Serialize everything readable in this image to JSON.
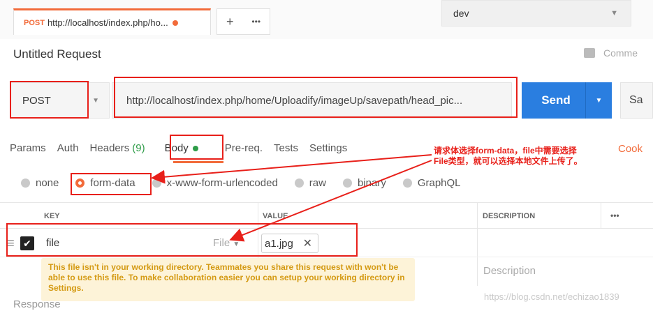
{
  "tabbar": {
    "tab": {
      "method": "POST",
      "url": "http://localhost/index.php/ho..."
    },
    "new_tab": "+",
    "more": "•••",
    "environment": "dev"
  },
  "request": {
    "title": "Untitled Request",
    "comments": "Comme",
    "method": "POST",
    "url": "http://localhost/index.php/home/Uploadify/imageUp/savepath/head_pic...",
    "send": "Send",
    "save": "Sa"
  },
  "req_tabs": {
    "params": "Params",
    "auth": "Auth",
    "headers": "Headers",
    "headers_count": "(9)",
    "body": "Body",
    "prereq": "Pre-req.",
    "tests": "Tests",
    "settings": "Settings",
    "cookies": "Cook"
  },
  "body_types": [
    "none",
    "form-data",
    "x-www-form-urlencoded",
    "raw",
    "binary",
    "GraphQL"
  ],
  "body_type_selected": "form-data",
  "table": {
    "headers": {
      "key": "KEY",
      "value": "VALUE",
      "description": "DESCRIPTION",
      "more": "•••"
    },
    "rows": [
      {
        "key": "file",
        "type": "File",
        "value": "a1.jpg"
      }
    ],
    "description_placeholder": "Description"
  },
  "warning": "This file isn't in your working directory. Teammates you share this request with won't be able to use this file. To make collaboration easier you can setup your working directory in Settings.",
  "response_label": "Response",
  "annotation": {
    "line1": "请求体选择form-data，file中需要选择",
    "line2": "File类型，就可以选择本地文件上传了。"
  },
  "watermark": "https://blog.csdn.net/echizao1839",
  "colors": {
    "accent": "#f26b3a",
    "send": "#2a7ee0",
    "annotation": "#e8201a",
    "green": "#2e9c48"
  }
}
